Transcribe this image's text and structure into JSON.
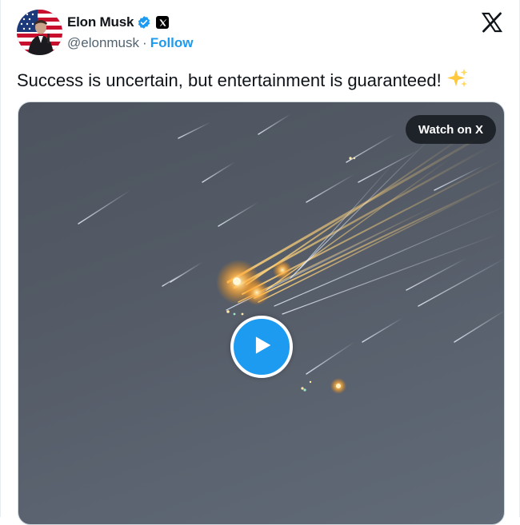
{
  "author": {
    "display_name": "Elon Musk",
    "handle": "@elonmusk",
    "separator": "·",
    "follow_label": "Follow",
    "verified_color": "#1d9bf0"
  },
  "tweet": {
    "text": "Success is uncertain, but entertainment is guaranteed!",
    "emoji": "sparkles-icon"
  },
  "media": {
    "watch_label": "Watch on X",
    "play_icon": "play-icon"
  },
  "colors": {
    "accent": "#1d9bf0",
    "text": "#0f1419",
    "muted": "#536471"
  }
}
